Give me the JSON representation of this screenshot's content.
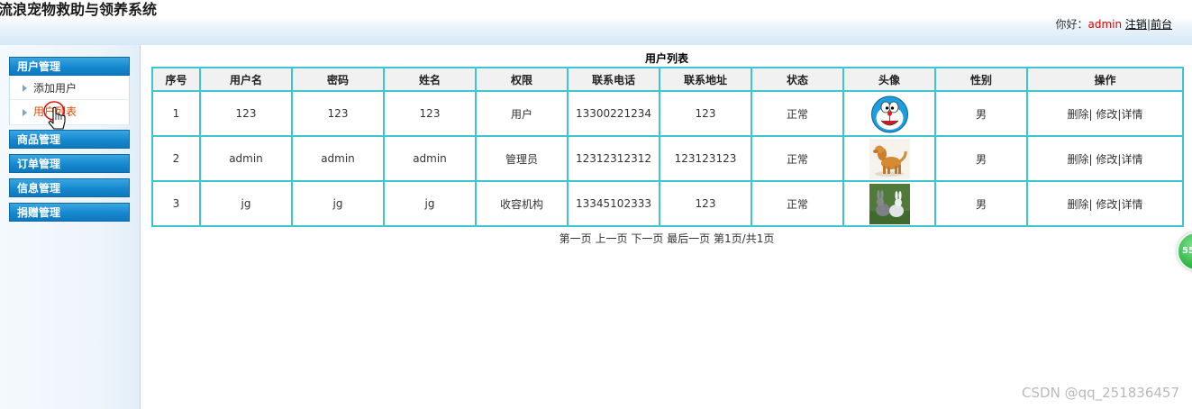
{
  "app": {
    "title": "流浪宠物救助与领养系统"
  },
  "user_bar": {
    "greeting": "你好：",
    "username": "admin",
    "logout": "注销",
    "separator": "|",
    "frontend": "前台"
  },
  "sidebar": {
    "groups": [
      {
        "label": "用户管理",
        "items": [
          {
            "label": "添加用户"
          },
          {
            "label": "用户列表"
          }
        ]
      },
      {
        "label": "商品管理"
      },
      {
        "label": "订单管理"
      },
      {
        "label": "信息管理"
      },
      {
        "label": "捐赠管理"
      }
    ],
    "active_item": "用户列表"
  },
  "main": {
    "list_title": "用户列表",
    "columns": [
      "序号",
      "用户名",
      "密码",
      "姓名",
      "权限",
      "联系电话",
      "联系地址",
      "状态",
      "头像",
      "性别",
      "操作"
    ],
    "rows": [
      {
        "index": "1",
        "username": "123",
        "password": "123",
        "name": "123",
        "role": "用户",
        "phone": "13300221234",
        "address": "123",
        "status": "正常",
        "avatar": "doraemon-avatar",
        "gender": "男"
      },
      {
        "index": "2",
        "username": "admin",
        "password": "admin",
        "name": "admin",
        "role": "管理员",
        "phone": "12312312312",
        "address": "123123123",
        "status": "正常",
        "avatar": "dog-avatar",
        "gender": "男"
      },
      {
        "index": "3",
        "username": "jg",
        "password": "jg",
        "name": "jg",
        "role": "收容机构",
        "phone": "13345102333",
        "address": "123",
        "status": "正常",
        "avatar": "rabbits-avatar",
        "gender": "男"
      }
    ],
    "actions": {
      "delete": "删除",
      "edit": "修改",
      "detail": "详情"
    },
    "pager": {
      "first": "第一页",
      "prev": "上一页",
      "next": "下一页",
      "last": "最后一页",
      "info": "第1页/共1页"
    }
  },
  "floating_button": {
    "label": "55"
  },
  "watermark": "CSDN @qq_251836457",
  "colors": {
    "menu_header": "#1588cf",
    "table_border": "#3ec6cf",
    "username": "#e00000",
    "active_item": "#e04a00"
  }
}
